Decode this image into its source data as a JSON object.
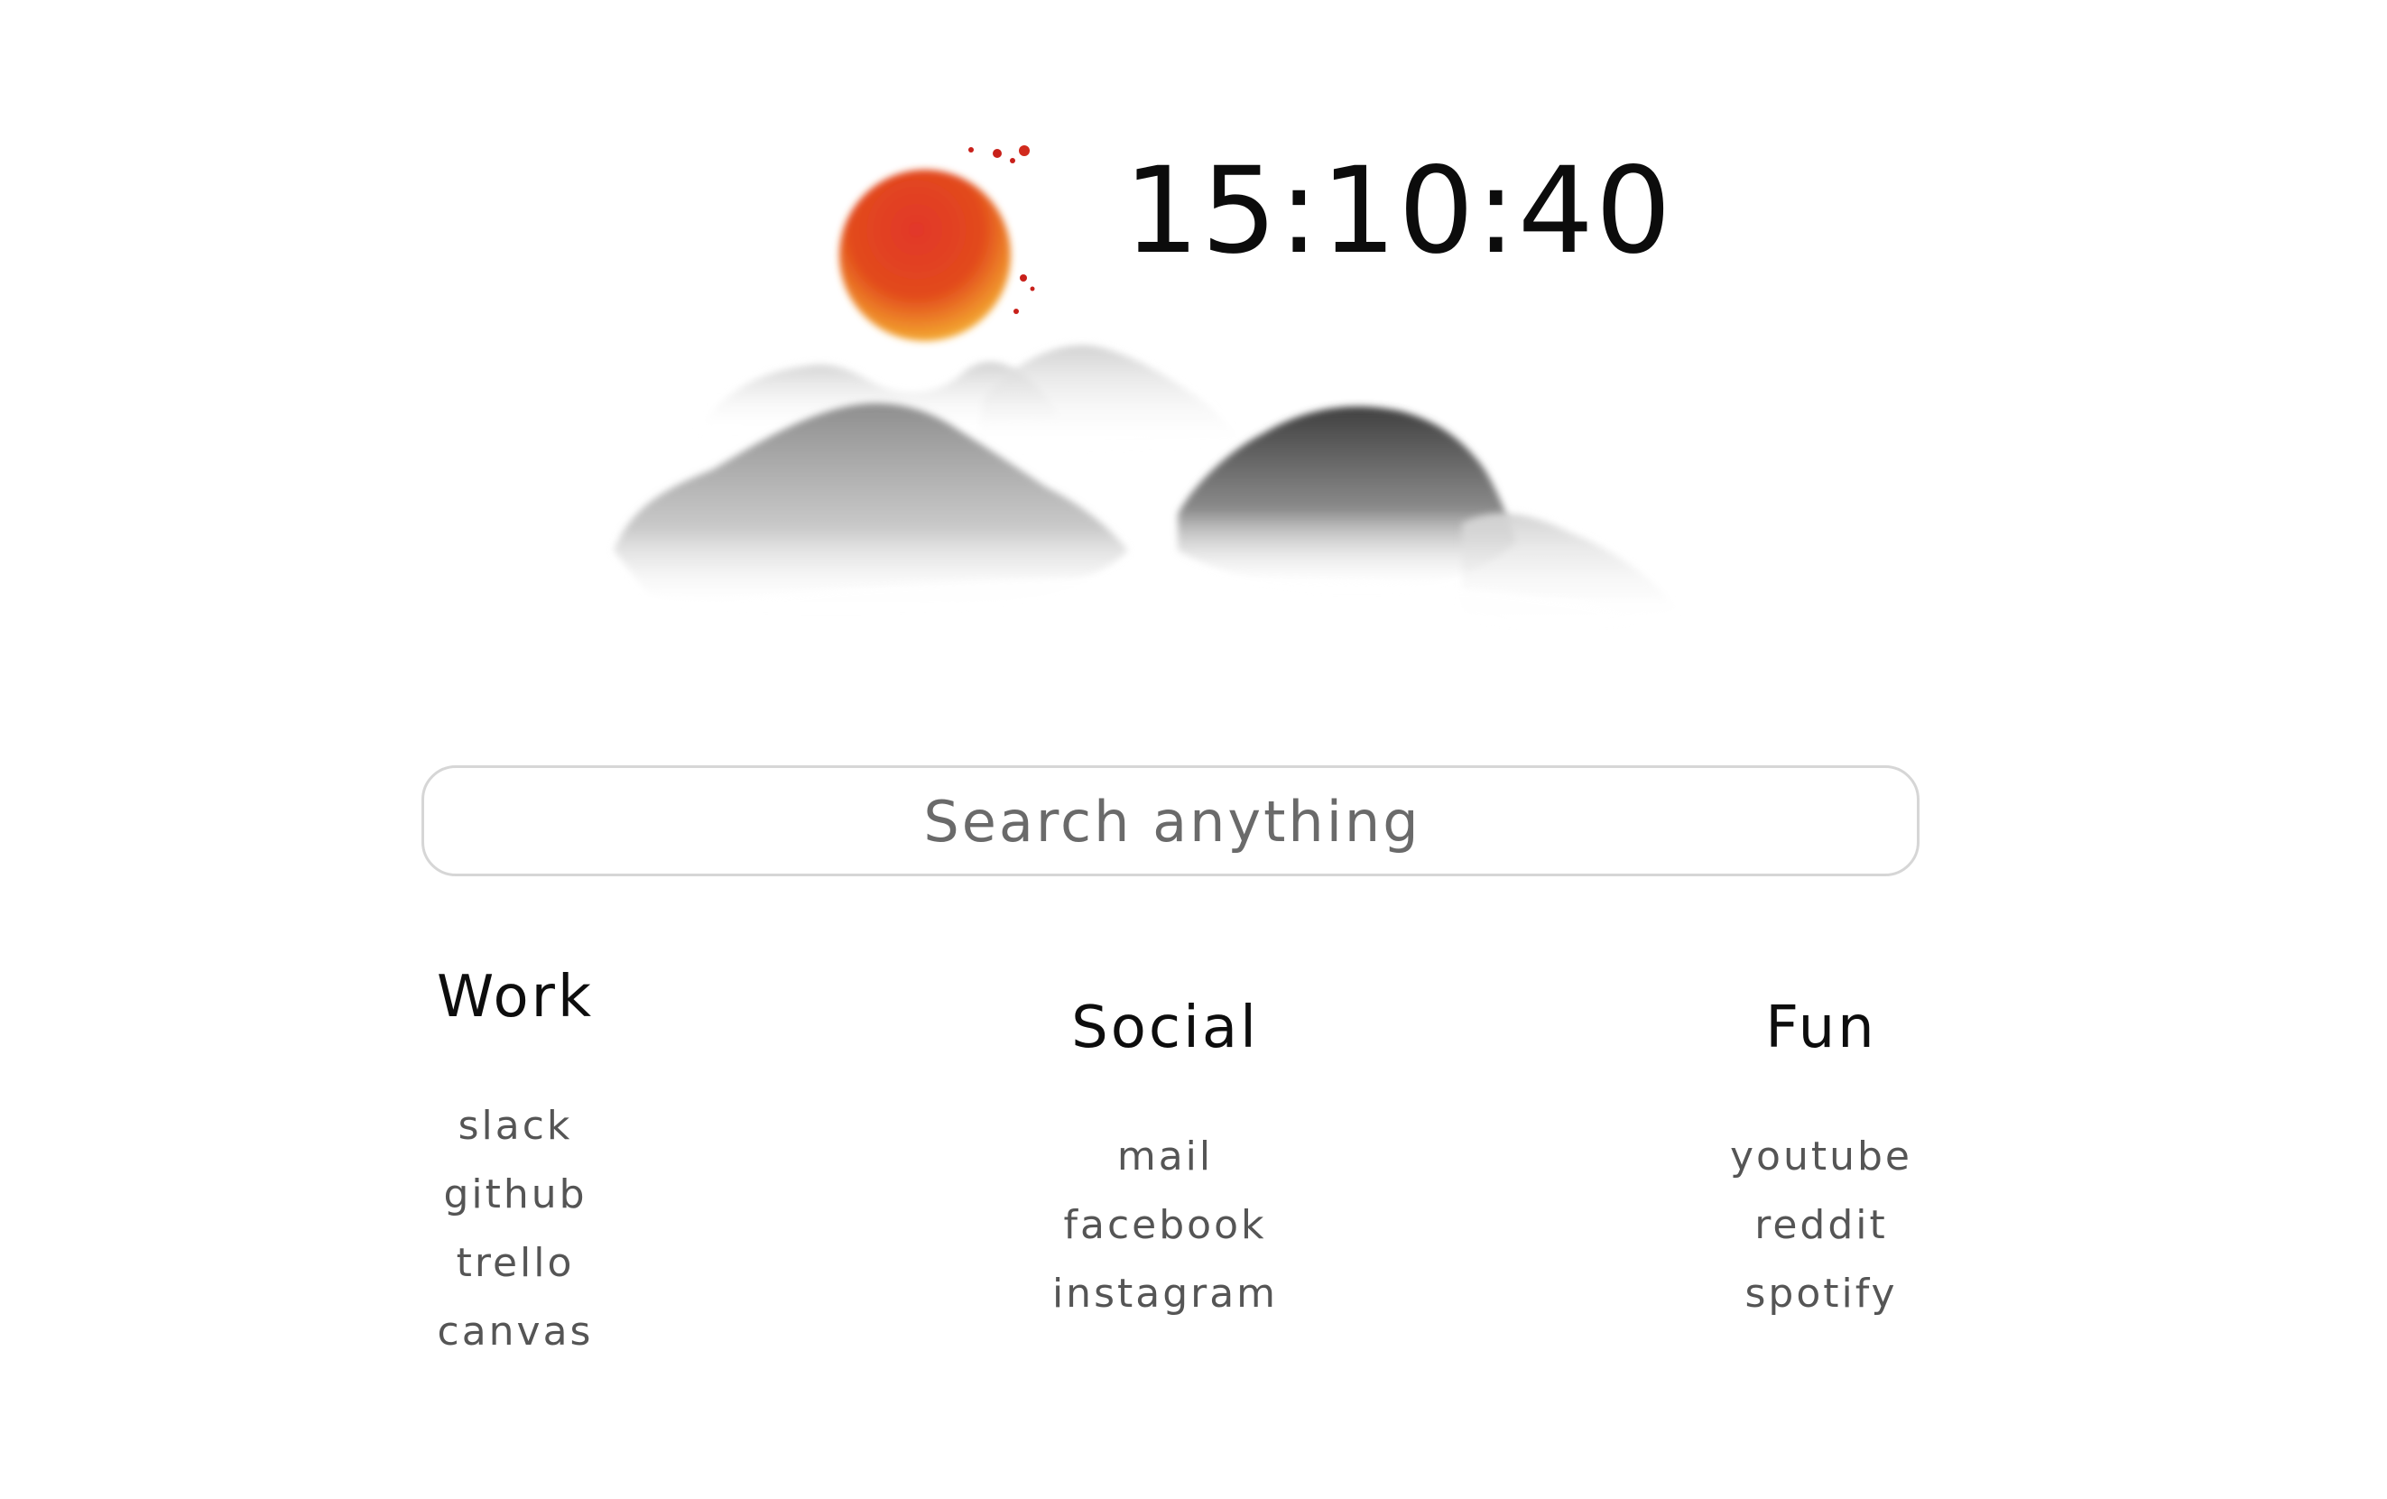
{
  "clock": {
    "time": "15:10:40"
  },
  "search": {
    "placeholder": "Search anything"
  },
  "columns": [
    {
      "title": "Work",
      "links": [
        "slack",
        "github",
        "trello",
        "canvas"
      ]
    },
    {
      "title": "Social",
      "links": [
        "mail",
        "facebook",
        "instagram"
      ]
    },
    {
      "title": "Fun",
      "links": [
        "youtube",
        "reddit",
        "spotify"
      ]
    }
  ],
  "colors": {
    "sun_top": "#d8261b",
    "sun_bottom": "#f6b52e",
    "mountain_dark": "#4a4a4a",
    "mountain_light": "#d7d7d7",
    "link_text": "#555555",
    "search_border": "#d6d6d6"
  },
  "illustration": {
    "icons": [
      "sun-icon",
      "mountains-icon"
    ]
  }
}
